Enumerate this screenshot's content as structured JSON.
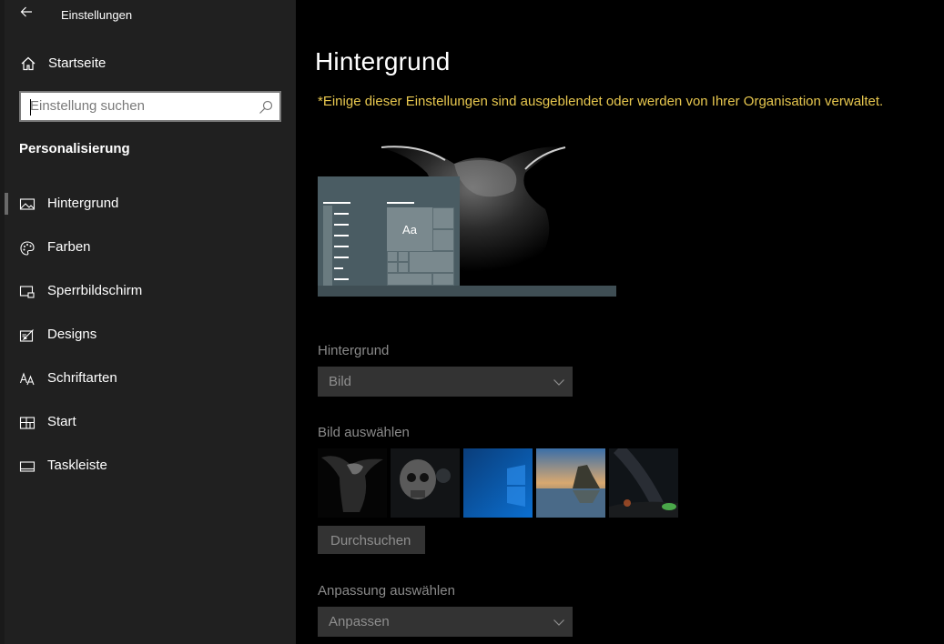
{
  "window": {
    "title": "Einstellungen"
  },
  "sidebar": {
    "home_label": "Startseite",
    "search": {
      "placeholder": "Einstellung suchen"
    },
    "section_title": "Personalisierung",
    "items": [
      {
        "label": "Hintergrund",
        "icon": "picture-icon",
        "selected": true
      },
      {
        "label": "Farben",
        "icon": "palette-icon",
        "selected": false
      },
      {
        "label": "Sperrbildschirm",
        "icon": "lock-screen-icon",
        "selected": false
      },
      {
        "label": "Designs",
        "icon": "designs-icon",
        "selected": false
      },
      {
        "label": "Schriftarten",
        "icon": "fonts-icon",
        "selected": false
      },
      {
        "label": "Start",
        "icon": "start-icon",
        "selected": false
      },
      {
        "label": "Taskleiste",
        "icon": "taskbar-icon",
        "selected": false
      }
    ]
  },
  "main": {
    "title": "Hintergrund",
    "policy_notice": "*Einige dieser Einstellungen sind ausgeblendet oder werden von Ihrer Organisation verwaltet.",
    "preview": {
      "tile_text": "Aa"
    },
    "background_label": "Hintergrund",
    "background_value": "Bild",
    "choose_picture_label": "Bild auswählen",
    "browse_label": "Durchsuchen",
    "fit_label": "Anpassung auswählen",
    "fit_value": "Anpassen"
  },
  "colors": {
    "sidebar_bg": "#202020",
    "main_bg": "#000000",
    "policy_text": "#e8c84f",
    "control_bg": "#333333",
    "preview_accent": "#4a5c63"
  }
}
